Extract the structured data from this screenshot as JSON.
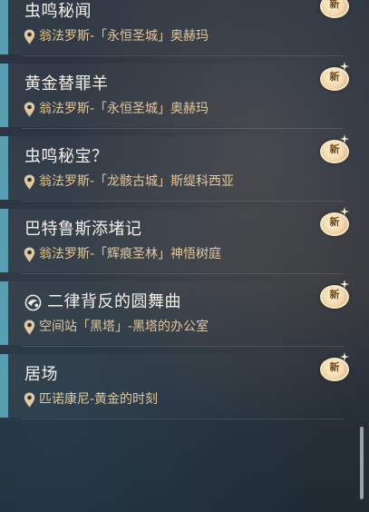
{
  "badge_label": "新",
  "colors": {
    "accent": "#5fb3c4",
    "title": "#f3efe8",
    "location": "#e2c89a",
    "badge": "#f3d9a8"
  },
  "quests": [
    {
      "title": "虫鸣秘闻",
      "location": "翁法罗斯-「永恒圣城」奥赫玛",
      "has_type_icon": false,
      "is_new": true
    },
    {
      "title": "黄金替罪羊",
      "location": "翁法罗斯-「永恒圣城」奥赫玛",
      "has_type_icon": false,
      "is_new": true
    },
    {
      "title": "虫鸣秘宝？",
      "location": "翁法罗斯-「龙骸古城」斯缇科西亚",
      "has_type_icon": false,
      "is_new": true
    },
    {
      "title": "巴特鲁斯添堵记",
      "location": "翁法罗斯-「辉痕圣林」神悟树庭",
      "has_type_icon": false,
      "is_new": true
    },
    {
      "title": "二律背反的圆舞曲",
      "location": "空间站「黑塔」-黑塔的办公室",
      "has_type_icon": true,
      "type_icon": "dancing-swirl-icon",
      "is_new": true
    },
    {
      "title": "居场",
      "location": "匹诺康尼-黄金的时刻",
      "has_type_icon": false,
      "is_new": true
    }
  ]
}
